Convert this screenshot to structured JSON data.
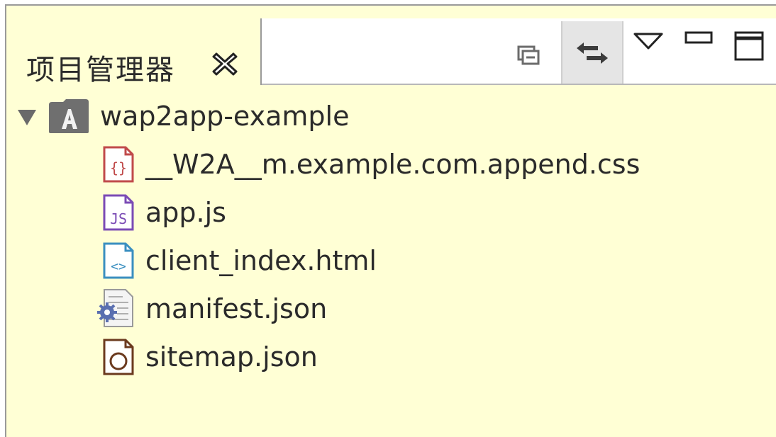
{
  "window": {
    "tab_title": "项目管理器"
  },
  "toolbar": {
    "buttons": [
      {
        "name": "collapse-all",
        "icon": "collapse-all-icon"
      },
      {
        "name": "link-with-editor",
        "icon": "link-with-editor-icon",
        "pressed": true
      },
      {
        "name": "view-menu",
        "icon": "view-menu-icon"
      },
      {
        "name": "minimize",
        "icon": "minimize-icon"
      },
      {
        "name": "maximize",
        "icon": "maximize-icon"
      }
    ]
  },
  "tree": {
    "project": {
      "label": "wap2app-example",
      "expanded": true,
      "icon": "app-project-icon"
    },
    "files": [
      {
        "label": "__W2A__m.example.com.append.css",
        "icon": "css-file-icon",
        "color": "#c04a4a"
      },
      {
        "label": "app.js",
        "icon": "js-file-icon",
        "color": "#7b4bb5"
      },
      {
        "label": "client_index.html",
        "icon": "html-file-icon",
        "color": "#3a8fc0"
      },
      {
        "label": "manifest.json",
        "icon": "manifest-file-icon",
        "color": "#5a6fb0"
      },
      {
        "label": "sitemap.json",
        "icon": "sitemap-file-icon",
        "color": "#6b3a1e"
      }
    ]
  },
  "colors": {
    "panel_background": "#ffffd5",
    "tab_strip_background": "#ffffff",
    "pressed_button": "#e5e5e5",
    "text": "#2a2a2a"
  }
}
